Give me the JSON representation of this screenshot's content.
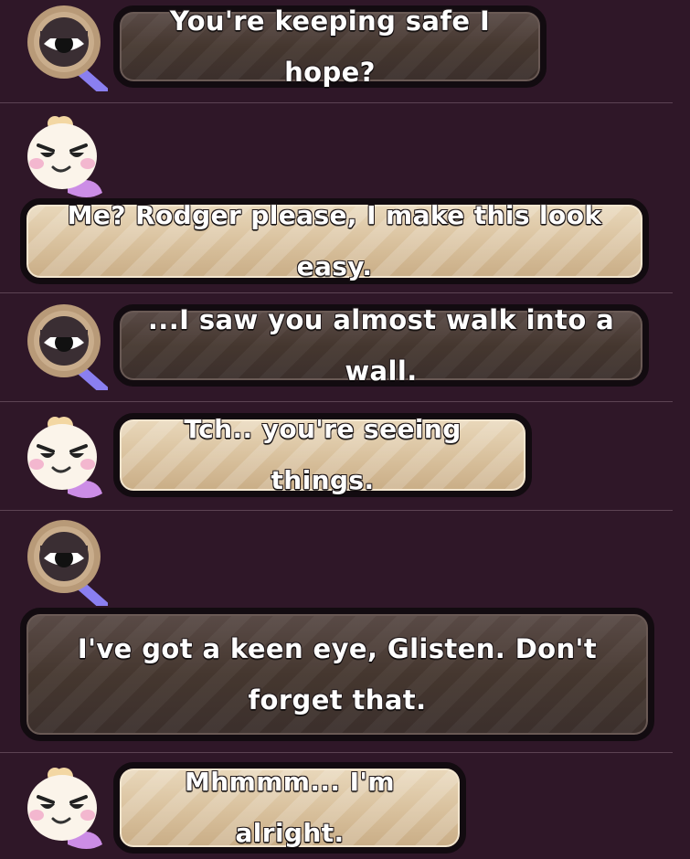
{
  "characters": {
    "rodger": {
      "name_icon": "eye-magnifier-avatar-icon"
    },
    "glisten": {
      "name_icon": "smug-fairy-avatar-icon"
    }
  },
  "messages": [
    {
      "speaker": "rodger",
      "style": "dark",
      "text": "You're keeping safe I hope?"
    },
    {
      "speaker": "glisten",
      "style": "light",
      "text": "Me? Rodger please, I make this look easy."
    },
    {
      "speaker": "rodger",
      "style": "dark",
      "text": "...I saw you almost walk into a wall."
    },
    {
      "speaker": "glisten",
      "style": "light",
      "text": "Tch.. you're seeing things."
    },
    {
      "speaker": "rodger",
      "style": "dark",
      "text": "I've got a keen eye, Glisten. Don't forget that."
    },
    {
      "speaker": "glisten",
      "style": "light",
      "text": "Mhmmm... I'm alright."
    }
  ],
  "colors": {
    "background": "#2f1728",
    "divider": "#5c4353",
    "dark_bubble": "#4a3c39",
    "light_bubble": "#dcc7a8",
    "bubble_border": "#120b10"
  }
}
